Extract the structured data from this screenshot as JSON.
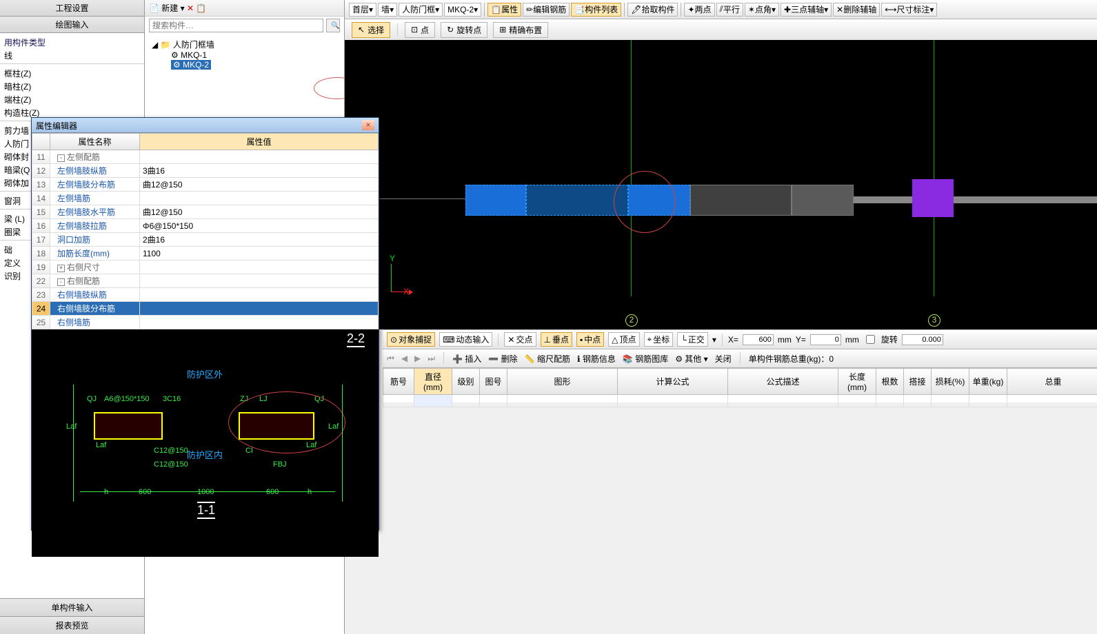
{
  "left": {
    "headers": [
      "工程设置",
      "绘图输入"
    ],
    "tree_top": [
      "用构件类型",
      "线"
    ],
    "cols": [
      "框柱(Z)",
      "暗柱(Z)",
      "端柱(Z)",
      "构造柱(Z)"
    ],
    "walls": [
      "剪力墙",
      "人防门",
      "砌体封",
      "暗梁(Q",
      "砌体加"
    ],
    "window": [
      "窗洞"
    ],
    "beams": [
      "梁 (L)",
      "圈梁"
    ],
    "other": [
      "础",
      "定义",
      "识别"
    ],
    "bottom": [
      "单构件输入",
      "报表预览"
    ]
  },
  "tree": {
    "new": "新建",
    "search_ph": "搜索构件…",
    "parent": "人防门框墙",
    "children": [
      "MKQ-1",
      "MKQ-2"
    ]
  },
  "ribbon1": {
    "combos": [
      "首层",
      "墙",
      "人防门框",
      "MKQ-2"
    ],
    "btns": [
      "属性",
      "编辑钢筋",
      "构件列表",
      "拾取构件",
      "两点",
      "平行",
      "点角",
      "三点辅轴",
      "删除辅轴",
      "尺寸标注"
    ]
  },
  "ribbon2": {
    "select": "选择",
    "pt": "点",
    "rot": "旋转点",
    "precise": "精确布置"
  },
  "axis": {
    "a": "2",
    "b": "3"
  },
  "pe": {
    "title": "属性编辑器",
    "hdr_name": "属性名称",
    "hdr_val": "属性值",
    "rows": [
      {
        "n": "11",
        "t": "左侧配筋",
        "g": true,
        "sign": "-"
      },
      {
        "n": "12",
        "t": "左侧墙肢纵筋",
        "v": "3曲16"
      },
      {
        "n": "13",
        "t": "左侧墙肢分布筋",
        "v": "曲12@150"
      },
      {
        "n": "14",
        "t": "左侧墙筋",
        "v": ""
      },
      {
        "n": "15",
        "t": "左侧墙肢水平筋",
        "v": "曲12@150"
      },
      {
        "n": "16",
        "t": "左侧墙肢拉筋",
        "v": "Φ6@150*150"
      },
      {
        "n": "17",
        "t": "洞口加筋",
        "v": "2曲16"
      },
      {
        "n": "18",
        "t": "加筋长度(mm)",
        "v": "1100"
      },
      {
        "n": "19",
        "t": "右侧尺寸",
        "g": true,
        "sign": "+"
      },
      {
        "n": "22",
        "t": "右侧配筋",
        "g": true,
        "sign": "-"
      },
      {
        "n": "23",
        "t": "右侧墙肢纵筋",
        "v": ""
      },
      {
        "n": "24",
        "t": "右侧墙肢分布筋",
        "v": "",
        "sel": true
      },
      {
        "n": "25",
        "t": "右侧墙筋",
        "v": ""
      }
    ],
    "img": {
      "sec": "2-2",
      "out": "防护区外",
      "in": "防护区内",
      "sec2": "1-1",
      "lbls": {
        "qj": "QJ",
        "a6": "A6@150*150",
        "c16": "3C16",
        "zj": "ZJ",
        "lj": "LJ",
        "laf": "Laf",
        "ci": "CI",
        "fbj": "FBJ",
        "c12a": "C12@150",
        "c12b": "C12@150",
        "d600a": "600",
        "d1000": "1000",
        "d600b": "600",
        "h1": "h",
        "h2": "h"
      }
    }
  },
  "bb": {
    "snap": "对象捕捉",
    "dyn": "动态输入",
    "cross": "交点",
    "perp": "垂点",
    "mid": "中点",
    "top": "顶点",
    "coord": "坐标",
    "ortho": "正交",
    "x": "X=",
    "xv": "600",
    "xu": "mm",
    "y": "Y=",
    "yv": "0",
    "yu": "mm",
    "rot": "旋转",
    "rotv": "0.000"
  },
  "row2": {
    "ins": "插入",
    "del": "删除",
    "scale": "缩尺配筋",
    "info": "钢筋信息",
    "lib": "钢筋图库",
    "other": "其他",
    "close": "关闭",
    "wt": "单构件钢筋总重(kg)：0"
  },
  "tbl": {
    "cols": [
      "筋号",
      "直径(mm)",
      "级别",
      "图号",
      "图形",
      "计算公式",
      "公式描述",
      "长度(mm)",
      "根数",
      "搭接",
      "损耗(%)",
      "单重(kg)",
      "总重"
    ]
  }
}
